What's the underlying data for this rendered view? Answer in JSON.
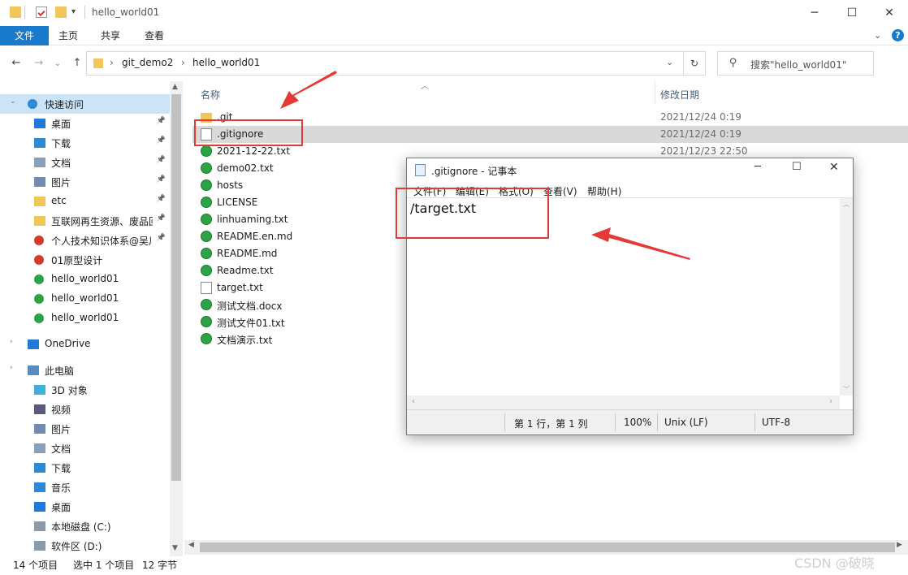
{
  "window": {
    "title": "hello_world01",
    "ribbon_tabs": [
      "文件",
      "主页",
      "共享",
      "查看"
    ]
  },
  "address": {
    "crumbs": [
      "git_demo2",
      "hello_world01"
    ],
    "search_placeholder": "搜索\"hello_world01\""
  },
  "nav": {
    "items": [
      {
        "label": "快速访问",
        "icon": "star-icon"
      },
      {
        "label": "桌面",
        "icon": "desktop-icon"
      },
      {
        "label": "下载",
        "icon": "download-icon"
      },
      {
        "label": "文档",
        "icon": "document-icon"
      },
      {
        "label": "图片",
        "icon": "picture-icon"
      },
      {
        "label": "etc",
        "icon": "folder-icon"
      },
      {
        "label": "互联网再生资源、废品回收",
        "icon": "folder-icon"
      },
      {
        "label": "个人技术知识体系@吴川华",
        "icon": "git-conflict-icon"
      },
      {
        "label": "01原型设计",
        "icon": "git-conflict-icon"
      },
      {
        "label": "hello_world01",
        "icon": "git-ok-icon"
      },
      {
        "label": "hello_world01",
        "icon": "git-ok-icon"
      },
      {
        "label": "hello_world01",
        "icon": "git-ok-icon"
      },
      {
        "label": "OneDrive",
        "icon": "cloud-icon"
      },
      {
        "label": "此电脑",
        "icon": "computer-icon"
      },
      {
        "label": "3D 对象",
        "icon": "cube-icon"
      },
      {
        "label": "视频",
        "icon": "video-icon"
      },
      {
        "label": "图片",
        "icon": "picture-icon"
      },
      {
        "label": "文档",
        "icon": "document-icon"
      },
      {
        "label": "下载",
        "icon": "download-icon"
      },
      {
        "label": "音乐",
        "icon": "music-icon"
      },
      {
        "label": "桌面",
        "icon": "desktop-icon"
      },
      {
        "label": "本地磁盘 (C:)",
        "icon": "drive-icon"
      },
      {
        "label": "软件区 (D:)",
        "icon": "drive-icon"
      }
    ]
  },
  "list": {
    "col_name": "名称",
    "col_date": "修改日期",
    "files": [
      {
        "name": ".git",
        "date": "2021/12/24 0:19",
        "icon": "folder-icon"
      },
      {
        "name": ".gitignore",
        "date": "2021/12/24 0:19",
        "icon": "text-file-icon"
      },
      {
        "name": "2021-12-22.txt",
        "date": "2021/12/23 22:50",
        "icon": "git-ok-icon"
      },
      {
        "name": "demo02.txt",
        "date": "",
        "icon": "git-ok-icon"
      },
      {
        "name": "hosts",
        "date": "",
        "icon": "git-ok-icon"
      },
      {
        "name": "LICENSE",
        "date": "",
        "icon": "git-ok-icon"
      },
      {
        "name": "linhuaming.txt",
        "date": "",
        "icon": "git-ok-icon"
      },
      {
        "name": "README.en.md",
        "date": "",
        "icon": "git-ok-icon"
      },
      {
        "name": "README.md",
        "date": "",
        "icon": "git-ok-icon"
      },
      {
        "name": "Readme.txt",
        "date": "",
        "icon": "git-ok-icon"
      },
      {
        "name": "target.txt",
        "date": "",
        "icon": "text-file-icon"
      },
      {
        "name": "测试文档.docx",
        "date": "",
        "icon": "git-ok-icon"
      },
      {
        "name": "测试文件01.txt",
        "date": "",
        "icon": "git-ok-icon"
      },
      {
        "name": "文档演示.txt",
        "date": "",
        "icon": "git-ok-icon"
      }
    ]
  },
  "status": {
    "count": "14 个项目",
    "selected": "选中 1 个项目",
    "size": "12 字节"
  },
  "notepad": {
    "title": ".gitignore - 记事本",
    "menus": [
      "文件(F)",
      "编辑(E)",
      "格式(O)",
      "查看(V)",
      "帮助(H)"
    ],
    "content": "/target.txt",
    "status_pos": "第 1 行，第 1 列",
    "status_zoom": "100%",
    "status_eol": "Unix (LF)",
    "status_enc": "UTF-8"
  },
  "watermark": "CSDN @破晓"
}
